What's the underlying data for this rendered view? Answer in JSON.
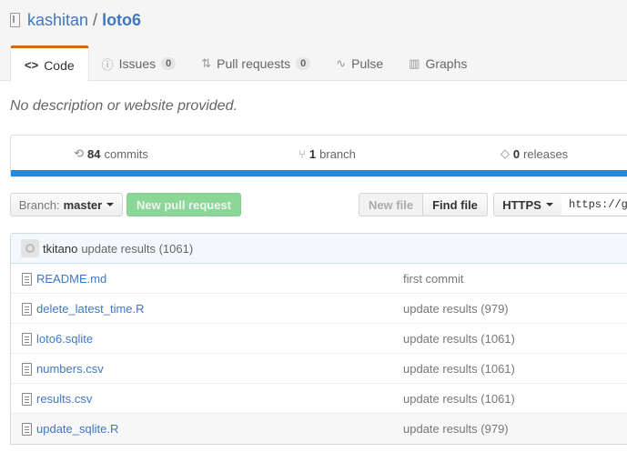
{
  "repo": {
    "owner": "kashitan",
    "separator": "/",
    "name": "loto6"
  },
  "tabs": [
    {
      "icon": "<>",
      "label": "Code",
      "count": null
    },
    {
      "icon": "ⓘ",
      "label": "Issues",
      "count": "0"
    },
    {
      "icon": "⇅",
      "label": "Pull requests",
      "count": "0"
    },
    {
      "icon": "∿",
      "label": "Pulse",
      "count": null
    },
    {
      "icon": "▥",
      "label": "Graphs",
      "count": null
    }
  ],
  "description": "No description or website provided.",
  "numbers": {
    "commits": {
      "value": "84",
      "label": "commits"
    },
    "branches": {
      "value": "1",
      "label": "branch"
    },
    "releases": {
      "value": "0",
      "label": "releases"
    }
  },
  "colors": {
    "lang_bar": "#198ce7",
    "accent": "#d26911",
    "link": "#4078c0"
  },
  "toolbar": {
    "branch_label": "Branch:",
    "branch_value": "master",
    "new_pr": "New pull request",
    "new_file": "New file",
    "find_file": "Find file",
    "protocol": "HTTPS",
    "clone_url": "https://gi"
  },
  "latest_commit": {
    "author": "tkitano",
    "message": "update results (1061)"
  },
  "files": [
    {
      "name": "README.md",
      "message": "first commit"
    },
    {
      "name": "delete_latest_time.R",
      "message": "update results (979)"
    },
    {
      "name": "loto6.sqlite",
      "message": "update results (1061)"
    },
    {
      "name": "numbers.csv",
      "message": "update results (1061)"
    },
    {
      "name": "results.csv",
      "message": "update results (1061)"
    },
    {
      "name": "update_sqlite.R",
      "message": "update results (979)"
    }
  ]
}
